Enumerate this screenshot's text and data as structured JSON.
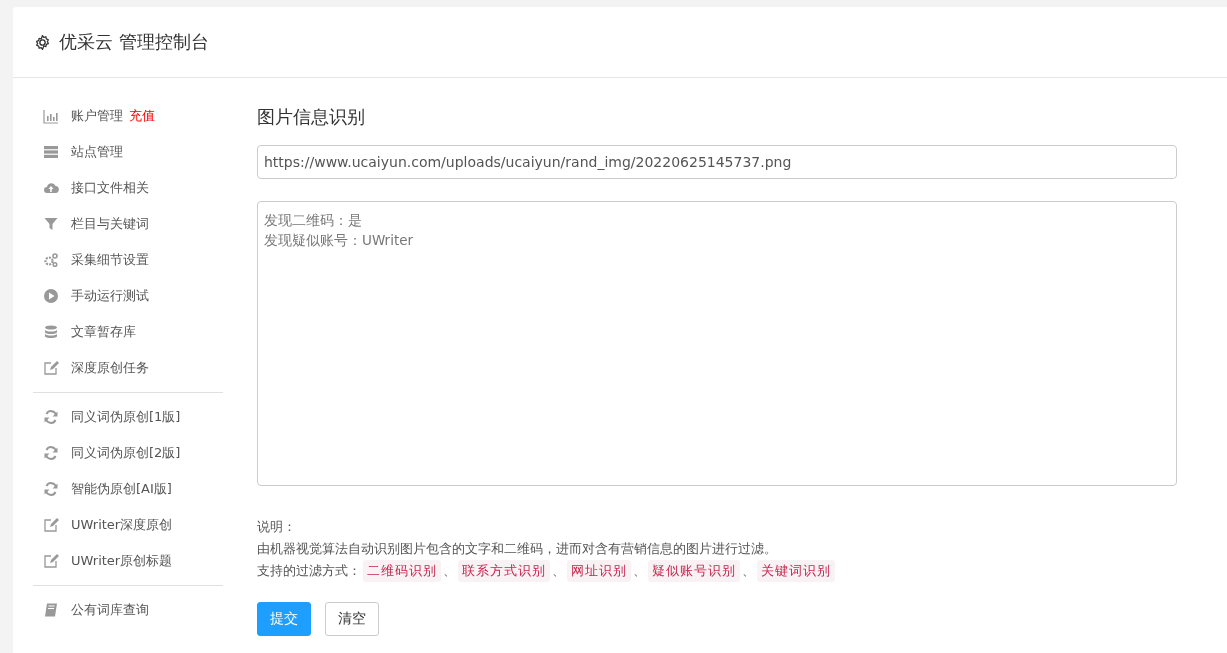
{
  "header": {
    "title": "优采云 管理控制台"
  },
  "sidebar": {
    "groups": [
      {
        "items": [
          {
            "label": "账户管理",
            "badge": "充值"
          },
          {
            "label": "站点管理"
          },
          {
            "label": "接口文件相关"
          },
          {
            "label": "栏目与关键词"
          },
          {
            "label": "采集细节设置"
          },
          {
            "label": "手动运行测试"
          },
          {
            "label": "文章暂存库"
          },
          {
            "label": "深度原创任务"
          }
        ]
      },
      {
        "items": [
          {
            "label": "同义词伪原创[1版]"
          },
          {
            "label": "同义词伪原创[2版]"
          },
          {
            "label": "智能伪原创[AI版]"
          },
          {
            "label": "UWriter深度原创"
          },
          {
            "label": "UWriter原创标题"
          }
        ]
      },
      {
        "items": [
          {
            "label": "公有词库查询"
          }
        ]
      }
    ]
  },
  "main": {
    "title": "图片信息识别",
    "url_field": {
      "value": "https://www.ucaiyun.com/uploads/ucaiyun/rand_img/20220625145737.png"
    },
    "result_box": {
      "lines": [
        "发现二维码：是",
        "发现疑似账号：UWriter"
      ]
    },
    "notes": {
      "heading": "说明：",
      "description": "由机器视觉算法自动识别图片包含的文字和二维码，进而对含有营销信息的图片进行过滤。",
      "filters_label": "支持的过滤方式：",
      "separator": "、",
      "filters": [
        "二维码识别",
        "联系方式识别",
        "网址识别",
        "疑似账号识别",
        "关键词识别"
      ]
    },
    "buttons": [
      {
        "label": "提交",
        "kind": "primary"
      },
      {
        "label": "清空",
        "kind": "default"
      }
    ]
  }
}
